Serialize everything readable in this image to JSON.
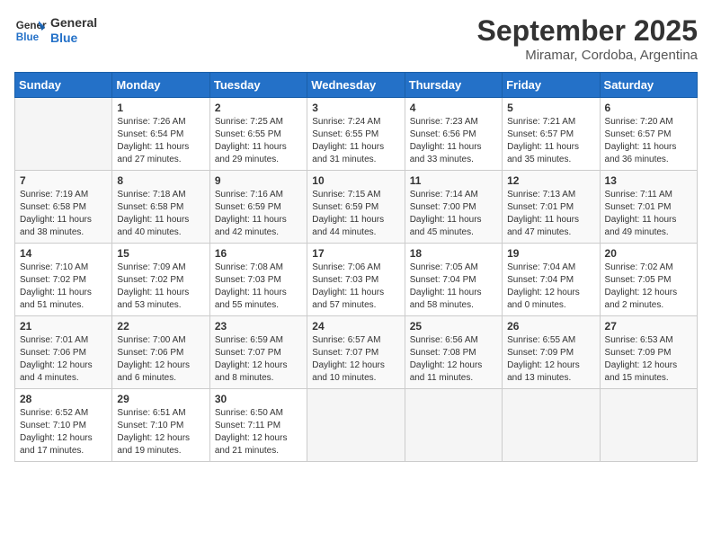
{
  "logo": {
    "line1": "General",
    "line2": "Blue"
  },
  "title": "September 2025",
  "location": "Miramar, Cordoba, Argentina",
  "weekdays": [
    "Sunday",
    "Monday",
    "Tuesday",
    "Wednesday",
    "Thursday",
    "Friday",
    "Saturday"
  ],
  "weeks": [
    [
      {
        "day": "",
        "info": ""
      },
      {
        "day": "1",
        "info": "Sunrise: 7:26 AM\nSunset: 6:54 PM\nDaylight: 11 hours\nand 27 minutes."
      },
      {
        "day": "2",
        "info": "Sunrise: 7:25 AM\nSunset: 6:55 PM\nDaylight: 11 hours\nand 29 minutes."
      },
      {
        "day": "3",
        "info": "Sunrise: 7:24 AM\nSunset: 6:55 PM\nDaylight: 11 hours\nand 31 minutes."
      },
      {
        "day": "4",
        "info": "Sunrise: 7:23 AM\nSunset: 6:56 PM\nDaylight: 11 hours\nand 33 minutes."
      },
      {
        "day": "5",
        "info": "Sunrise: 7:21 AM\nSunset: 6:57 PM\nDaylight: 11 hours\nand 35 minutes."
      },
      {
        "day": "6",
        "info": "Sunrise: 7:20 AM\nSunset: 6:57 PM\nDaylight: 11 hours\nand 36 minutes."
      }
    ],
    [
      {
        "day": "7",
        "info": "Sunrise: 7:19 AM\nSunset: 6:58 PM\nDaylight: 11 hours\nand 38 minutes."
      },
      {
        "day": "8",
        "info": "Sunrise: 7:18 AM\nSunset: 6:58 PM\nDaylight: 11 hours\nand 40 minutes."
      },
      {
        "day": "9",
        "info": "Sunrise: 7:16 AM\nSunset: 6:59 PM\nDaylight: 11 hours\nand 42 minutes."
      },
      {
        "day": "10",
        "info": "Sunrise: 7:15 AM\nSunset: 6:59 PM\nDaylight: 11 hours\nand 44 minutes."
      },
      {
        "day": "11",
        "info": "Sunrise: 7:14 AM\nSunset: 7:00 PM\nDaylight: 11 hours\nand 45 minutes."
      },
      {
        "day": "12",
        "info": "Sunrise: 7:13 AM\nSunset: 7:01 PM\nDaylight: 11 hours\nand 47 minutes."
      },
      {
        "day": "13",
        "info": "Sunrise: 7:11 AM\nSunset: 7:01 PM\nDaylight: 11 hours\nand 49 minutes."
      }
    ],
    [
      {
        "day": "14",
        "info": "Sunrise: 7:10 AM\nSunset: 7:02 PM\nDaylight: 11 hours\nand 51 minutes."
      },
      {
        "day": "15",
        "info": "Sunrise: 7:09 AM\nSunset: 7:02 PM\nDaylight: 11 hours\nand 53 minutes."
      },
      {
        "day": "16",
        "info": "Sunrise: 7:08 AM\nSunset: 7:03 PM\nDaylight: 11 hours\nand 55 minutes."
      },
      {
        "day": "17",
        "info": "Sunrise: 7:06 AM\nSunset: 7:03 PM\nDaylight: 11 hours\nand 57 minutes."
      },
      {
        "day": "18",
        "info": "Sunrise: 7:05 AM\nSunset: 7:04 PM\nDaylight: 11 hours\nand 58 minutes."
      },
      {
        "day": "19",
        "info": "Sunrise: 7:04 AM\nSunset: 7:04 PM\nDaylight: 12 hours\nand 0 minutes."
      },
      {
        "day": "20",
        "info": "Sunrise: 7:02 AM\nSunset: 7:05 PM\nDaylight: 12 hours\nand 2 minutes."
      }
    ],
    [
      {
        "day": "21",
        "info": "Sunrise: 7:01 AM\nSunset: 7:06 PM\nDaylight: 12 hours\nand 4 minutes."
      },
      {
        "day": "22",
        "info": "Sunrise: 7:00 AM\nSunset: 7:06 PM\nDaylight: 12 hours\nand 6 minutes."
      },
      {
        "day": "23",
        "info": "Sunrise: 6:59 AM\nSunset: 7:07 PM\nDaylight: 12 hours\nand 8 minutes."
      },
      {
        "day": "24",
        "info": "Sunrise: 6:57 AM\nSunset: 7:07 PM\nDaylight: 12 hours\nand 10 minutes."
      },
      {
        "day": "25",
        "info": "Sunrise: 6:56 AM\nSunset: 7:08 PM\nDaylight: 12 hours\nand 11 minutes."
      },
      {
        "day": "26",
        "info": "Sunrise: 6:55 AM\nSunset: 7:09 PM\nDaylight: 12 hours\nand 13 minutes."
      },
      {
        "day": "27",
        "info": "Sunrise: 6:53 AM\nSunset: 7:09 PM\nDaylight: 12 hours\nand 15 minutes."
      }
    ],
    [
      {
        "day": "28",
        "info": "Sunrise: 6:52 AM\nSunset: 7:10 PM\nDaylight: 12 hours\nand 17 minutes."
      },
      {
        "day": "29",
        "info": "Sunrise: 6:51 AM\nSunset: 7:10 PM\nDaylight: 12 hours\nand 19 minutes."
      },
      {
        "day": "30",
        "info": "Sunrise: 6:50 AM\nSunset: 7:11 PM\nDaylight: 12 hours\nand 21 minutes."
      },
      {
        "day": "",
        "info": ""
      },
      {
        "day": "",
        "info": ""
      },
      {
        "day": "",
        "info": ""
      },
      {
        "day": "",
        "info": ""
      }
    ]
  ]
}
